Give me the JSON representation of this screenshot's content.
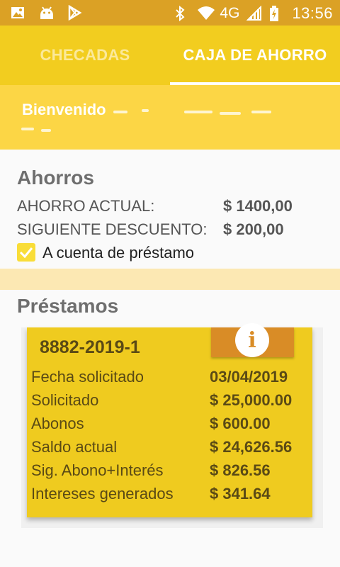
{
  "status_bar": {
    "time": "13:56",
    "network": "4G",
    "left_icons": [
      "image-icon",
      "android-icon",
      "play-store-icon"
    ],
    "right_icons": [
      "bluetooth-icon",
      "wifi-icon",
      "signal-icon",
      "battery-charging-icon"
    ]
  },
  "tabs": [
    {
      "label": "CHECADAS",
      "selected": false
    },
    {
      "label": "CAJA DE AHORRO",
      "selected": true
    }
  ],
  "welcome": {
    "greeting": "Bienvenido"
  },
  "savings": {
    "title": "Ahorros",
    "rows": [
      {
        "label": "AHORRO ACTUAL:",
        "value": "$ 1400,00"
      },
      {
        "label": "SIGUIENTE DESCUENTO:",
        "value": "$ 200,00"
      }
    ],
    "checkbox": {
      "label": "A cuenta de préstamo",
      "checked": true
    }
  },
  "loans": {
    "title": "Préstamos",
    "items": [
      {
        "id": "8882-2019-1",
        "rows": [
          {
            "label": "Fecha solicitado",
            "value": "03/04/2019"
          },
          {
            "label": "Solicitado",
            "value": "$ 25,000.00"
          },
          {
            "label": "Abonos",
            "value": "$ 600.00"
          },
          {
            "label": "Saldo actual",
            "value": "$ 24,626.56"
          },
          {
            "label": "Sig. Abono+Interés",
            "value": "$ 826.56"
          },
          {
            "label": "Intereses generados",
            "value": "$ 341.64"
          }
        ]
      }
    ]
  },
  "colors": {
    "status_bar": "#dba125",
    "tab_bar": "#f2cd1f",
    "welcome_bg": "#fcd645",
    "card_bg": "#efcb1f",
    "info_button": "#d98c26"
  }
}
